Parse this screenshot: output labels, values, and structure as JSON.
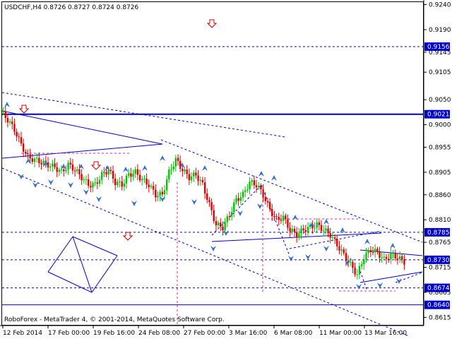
{
  "header": {
    "title": "USDCHF,H4  0.8726 0.8727 0.8724 0.8726"
  },
  "footer": {
    "copyright": "RoboForex - MetaTrader 4, © 2001-2014, MetaQuotes Software Corp."
  },
  "colors": {
    "bull": "#00C400",
    "bear": "#E00000",
    "line": "#0000CC",
    "tag_bg": "#0000CC",
    "arrow": "#D00000",
    "vline": "#CC3399",
    "fractal": "#2E6FD8"
  },
  "chart_data": {
    "type": "candlestick",
    "symbol": "USDCHF",
    "timeframe": "H4",
    "ylim": [
      0.86,
      0.9245
    ],
    "y_ticks": [
      "0.9240",
      "0.9190",
      "0.9145",
      "0.9105",
      "0.9050",
      "0.9000",
      "0.8955",
      "0.8905",
      "0.8860",
      "0.8810",
      "0.8765",
      "0.8715",
      "0.8665",
      "0.8615"
    ],
    "x_ticks": [
      "12 Feb 2014",
      "17 Feb 00:00",
      "19 Feb 16:00",
      "24 Feb 08:00",
      "27 Feb 00:00",
      "3 Mar 16:00",
      "6 Mar 08:00",
      "11 Mar 00:00",
      "13 Mar 16:00"
    ],
    "levels": [
      {
        "value": 0.9156,
        "label": "0.9156",
        "style": "dashed",
        "tag": true
      },
      {
        "value": 0.9021,
        "label": "0.9021",
        "style": "solid",
        "tag": true
      },
      {
        "value": 0.8785,
        "label": "0.8785",
        "style": "dashed",
        "tag": true
      },
      {
        "value": 0.873,
        "label": "0.8730",
        "style": "dashed",
        "tag": true
      },
      {
        "value": 0.8674,
        "label": "0.8674",
        "style": "dashed",
        "tag": true
      },
      {
        "value": 0.864,
        "label": "0.8640",
        "style": "solid",
        "tag": true
      }
    ],
    "close_path": [
      [
        0,
        0.9025
      ],
      [
        3,
        0.901
      ],
      [
        6,
        0.899
      ],
      [
        9,
        0.896
      ],
      [
        12,
        0.8935
      ],
      [
        15,
        0.893
      ],
      [
        18,
        0.8925
      ],
      [
        21,
        0.892
      ],
      [
        24,
        0.8915
      ],
      [
        27,
        0.8905
      ],
      [
        30,
        0.892
      ],
      [
        33,
        0.891
      ],
      [
        36,
        0.8895
      ],
      [
        39,
        0.888
      ],
      [
        42,
        0.888
      ],
      [
        45,
        0.89
      ],
      [
        48,
        0.891
      ],
      [
        51,
        0.8885
      ],
      [
        54,
        0.888
      ],
      [
        57,
        0.89
      ],
      [
        60,
        0.8905
      ],
      [
        63,
        0.889
      ],
      [
        66,
        0.888
      ],
      [
        69,
        0.886
      ],
      [
        72,
        0.886
      ],
      [
        75,
        0.8905
      ],
      [
        78,
        0.893
      ],
      [
        81,
        0.891
      ],
      [
        84,
        0.8895
      ],
      [
        87,
        0.89
      ],
      [
        90,
        0.888
      ],
      [
        93,
        0.884
      ],
      [
        96,
        0.88
      ],
      [
        99,
        0.8795
      ],
      [
        102,
        0.882
      ],
      [
        105,
        0.885
      ],
      [
        108,
        0.886
      ],
      [
        111,
        0.8885
      ],
      [
        114,
        0.888
      ],
      [
        117,
        0.886
      ],
      [
        120,
        0.883
      ],
      [
        123,
        0.881
      ],
      [
        126,
        0.8815
      ],
      [
        129,
        0.879
      ],
      [
        132,
        0.878
      ],
      [
        135,
        0.879
      ],
      [
        138,
        0.8795
      ],
      [
        141,
        0.88
      ],
      [
        144,
        0.879
      ],
      [
        147,
        0.878
      ],
      [
        150,
        0.876
      ],
      [
        153,
        0.874
      ],
      [
        156,
        0.872
      ],
      [
        159,
        0.87
      ],
      [
        162,
        0.8735
      ],
      [
        165,
        0.875
      ],
      [
        168,
        0.8745
      ],
      [
        171,
        0.873
      ],
      [
        174,
        0.874
      ],
      [
        177,
        0.8735
      ],
      [
        180,
        0.8726
      ]
    ]
  }
}
